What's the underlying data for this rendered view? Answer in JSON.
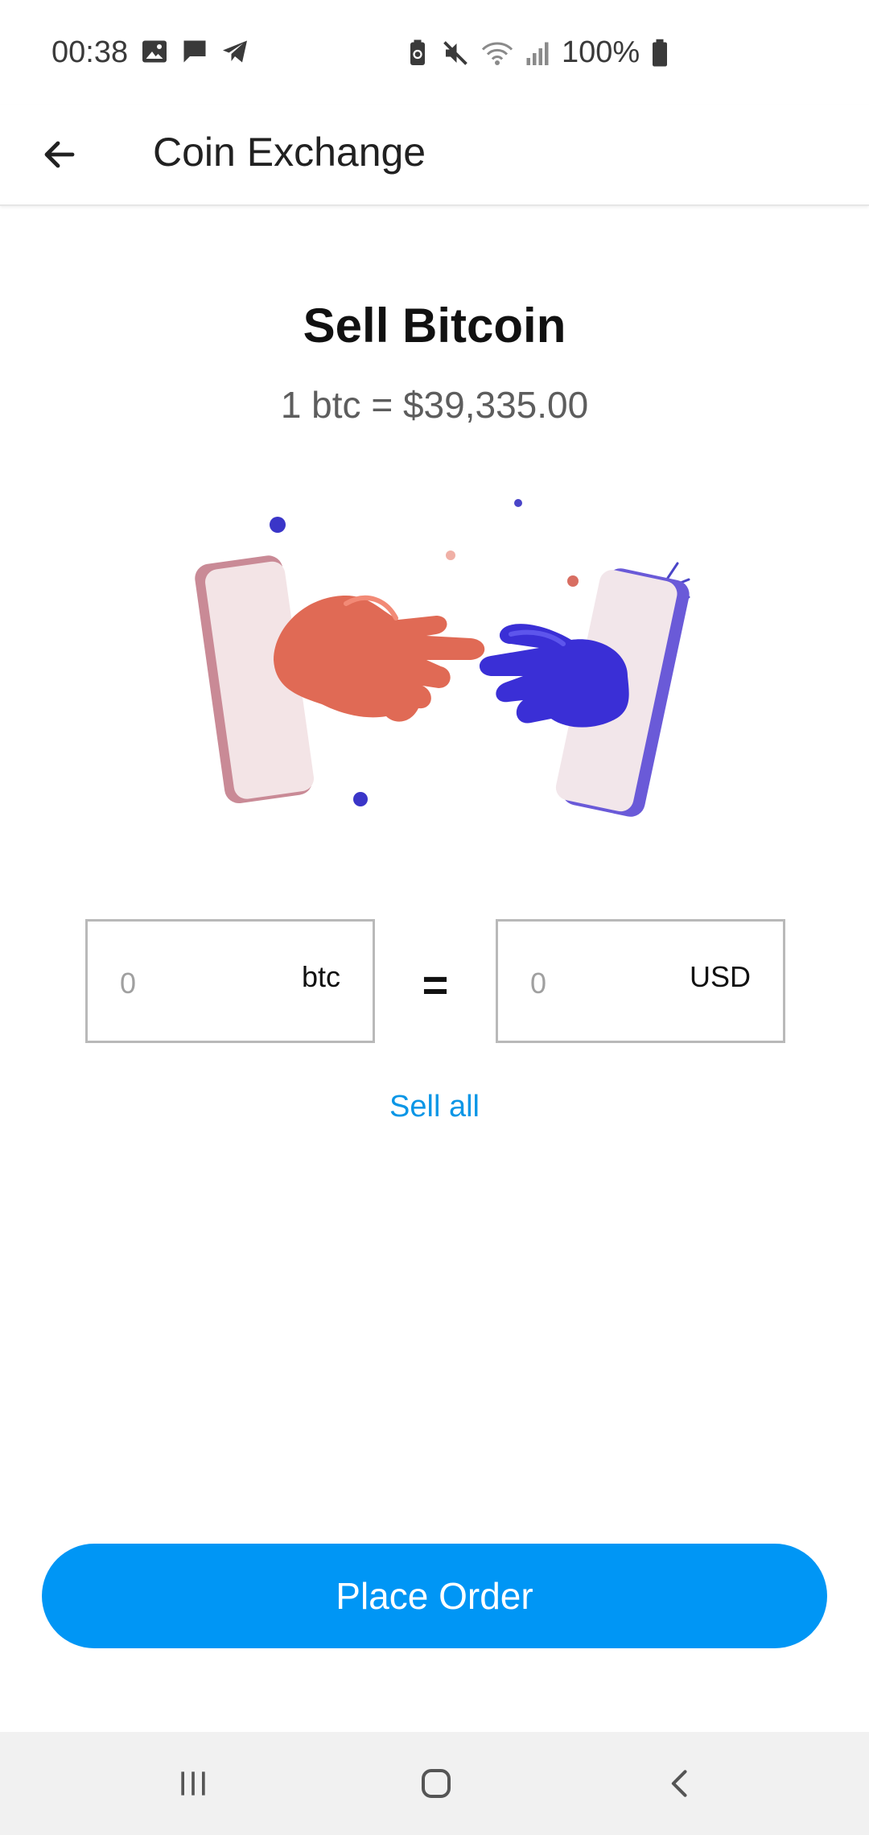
{
  "status_bar": {
    "time": "00:38",
    "battery_text": "100%",
    "left_icons": [
      "image-icon",
      "chat-icon",
      "telegram-icon"
    ],
    "right_icons": [
      "battery-saver-icon",
      "mute-icon",
      "wifi-icon",
      "signal-icon",
      "battery-icon"
    ]
  },
  "app_bar": {
    "title": "Coin Exchange",
    "back_icon": "arrow-back-icon"
  },
  "main": {
    "heading": "Sell Bitcoin",
    "rate": "1 btc = $39,335.00",
    "illustration": "handshake-phones-illustration",
    "btc_field": {
      "value": "0",
      "unit": "btc"
    },
    "equals": "=",
    "usd_field": {
      "value": "0",
      "unit": "USD"
    },
    "sell_all": "Sell all"
  },
  "actions": {
    "place_order": "Place Order"
  },
  "colors": {
    "accent": "#0096f5",
    "link": "#0a96e6",
    "hand_left": "#e06a55",
    "hand_right": "#3a2fd6"
  },
  "nav_bar": {
    "icons": [
      "recent-apps-icon",
      "home-icon",
      "back-icon"
    ]
  }
}
